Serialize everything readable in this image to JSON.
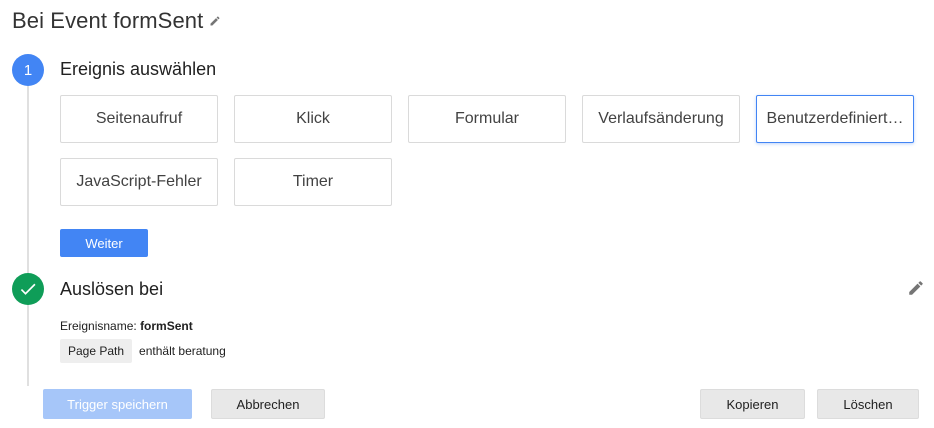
{
  "header": {
    "title": "Bei Event formSent"
  },
  "step1": {
    "number": "1",
    "heading": "Ereignis auswählen",
    "event_types": [
      {
        "label": "Seitenaufruf",
        "selected": false
      },
      {
        "label": "Klick",
        "selected": false
      },
      {
        "label": "Formular",
        "selected": false
      },
      {
        "label": "Verlaufsänderung",
        "selected": false
      },
      {
        "label": "Benutzerdefiniert…",
        "selected": true
      },
      {
        "label": "JavaScript-Fehler",
        "selected": false
      },
      {
        "label": "Timer",
        "selected": false
      }
    ],
    "next_label": "Weiter"
  },
  "step2": {
    "heading": "Auslösen bei",
    "event_name_label": "Ereignisname:",
    "event_name_value": "formSent",
    "condition": {
      "variable": "Page Path",
      "text": "enthält beratung"
    }
  },
  "footer": {
    "save_label": "Trigger speichern",
    "cancel_label": "Abbrechen",
    "copy_label": "Kopieren",
    "delete_label": "Löschen"
  },
  "colors": {
    "accent": "#4285f4",
    "success": "#0f9d58",
    "save_disabled": "#a6c6f9"
  },
  "icons": {
    "title_edit": "pencil-icon",
    "step_done": "check-icon",
    "step_edit": "pencil-icon"
  }
}
